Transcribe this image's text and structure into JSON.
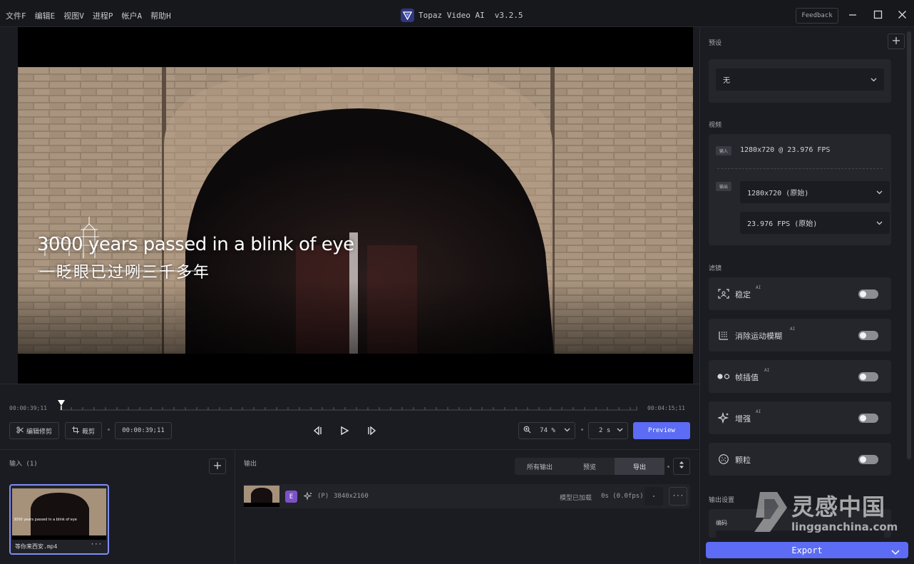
{
  "menu": [
    "文件F",
    "编辑E",
    "视图V",
    "进程P",
    "帐户A",
    "帮助H"
  ],
  "app": {
    "title": "Topaz Video AI",
    "version": "v3.2.5",
    "feedback": "Feedback"
  },
  "video": {
    "caption_en": "3000 years passed in a blink of eye",
    "caption_cn": "一眨眼已过咧三千多年"
  },
  "timeline": {
    "start_tc": "00:00:39;11",
    "end_tc": "00:04:15;11",
    "trim_label": "编辑修剪",
    "crop_label": "裁剪",
    "current_tc": "00:00:39;11",
    "zoom_value": "74 %",
    "duration_value": "2 s",
    "preview_label": "Preview"
  },
  "input_panel": {
    "title": "输入 (1)",
    "file_name": "等你来西安.mp4",
    "more": "···"
  },
  "output_panel": {
    "title": "输出",
    "tabs": [
      "所有输出",
      "预览",
      "导出"
    ],
    "row": {
      "badge": "E",
      "preset": "(P)",
      "resolution": "3840x2160",
      "status": "模型已加载",
      "time": "0s (0.0fps)",
      "more": "···"
    }
  },
  "right": {
    "preset_title": "预设",
    "preset_value": "无",
    "video_title": "视频",
    "input_tag": "输入",
    "input_value": "1280x720 @ 23.976 FPS",
    "output_tag": "输出",
    "output_res": "1280x720 (原始)",
    "output_fps": "23.976 FPS (原始)",
    "filters_title": "滤镜",
    "filters": [
      {
        "label": "稳定",
        "ai": "AI",
        "on": false,
        "icon": "stabilize-icon"
      },
      {
        "label": "消除运动模糊",
        "ai": "AI",
        "on": false,
        "icon": "motion-deblur-icon"
      },
      {
        "label": "帧插值",
        "ai": "AI",
        "on": false,
        "icon": "frame-interpolation-icon"
      },
      {
        "label": "增强",
        "ai": "AI",
        "on": false,
        "icon": "sparkle-icon"
      },
      {
        "label": "颗粒",
        "ai": "",
        "on": false,
        "icon": "grain-icon"
      }
    ],
    "output_settings_title": "输出设置",
    "codec_label": "编码",
    "export_label": "Export"
  },
  "watermark": {
    "cn": "灵感中国",
    "en": "lingganchina.com"
  },
  "colors": {
    "accent": "#5c6cf4",
    "selected_border": "#7f8df5",
    "bg": "#1b1c21"
  }
}
